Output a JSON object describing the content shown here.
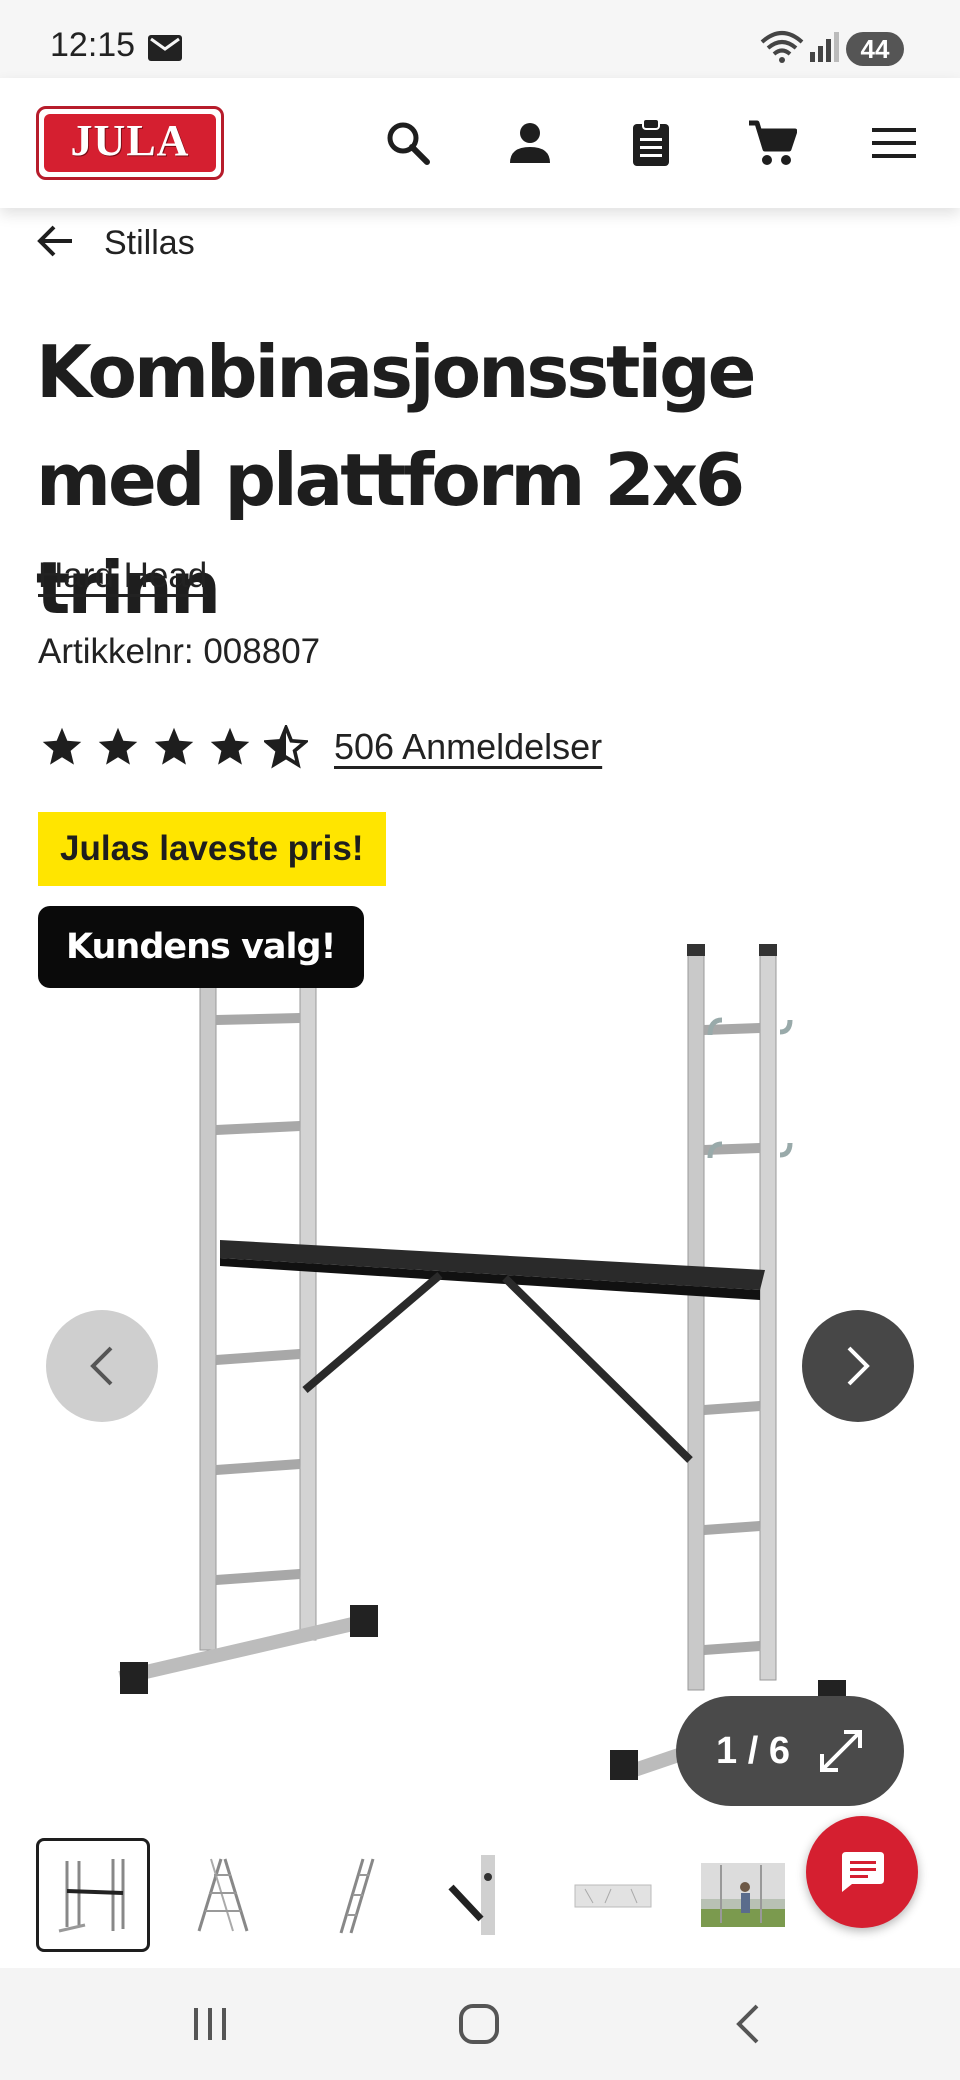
{
  "status_bar": {
    "time": "12:15",
    "battery": "44",
    "icons": [
      "mail-icon",
      "wifi-icon",
      "signal-icon",
      "battery-icon"
    ]
  },
  "header": {
    "logo_text": "JULA",
    "icons": [
      "search-icon",
      "account-icon",
      "shopping-list-icon",
      "cart-icon",
      "menu-icon"
    ]
  },
  "breadcrumb": {
    "label": "Stillas",
    "icon": "arrow-left-icon"
  },
  "product": {
    "title": "Kombinasjonsstige med plattform 2x6 trinn",
    "brand": "Hard Head",
    "sku_label": "Artikkelnr:",
    "sku": "008807",
    "rating": 4.5,
    "rating_max": 5,
    "reviews_label": "506 Anmeldelser",
    "badges": {
      "lowest_price": "Julas laveste pris!",
      "customer_choice": "Kundens valg!"
    }
  },
  "gallery": {
    "counter": "1 / 6",
    "current": 1,
    "total": 6,
    "icons": [
      "chevron-left-icon",
      "chevron-right-icon",
      "expand-icon"
    ],
    "thumbnails": [
      "thumb-ladder-platform",
      "thumb-a-frame-ladder",
      "thumb-straight-ladder",
      "thumb-detail-hinge",
      "thumb-platform-flat",
      "thumb-in-use-photo"
    ]
  },
  "chat": {
    "icon": "chat-icon"
  },
  "system_nav": {
    "icons": [
      "recent-apps-icon",
      "home-icon",
      "back-icon"
    ]
  },
  "colors": {
    "brand_red": "#d51f30",
    "badge_yellow": "#ffe500",
    "badge_black": "#0a0a0a",
    "text": "#1e1e1e"
  }
}
